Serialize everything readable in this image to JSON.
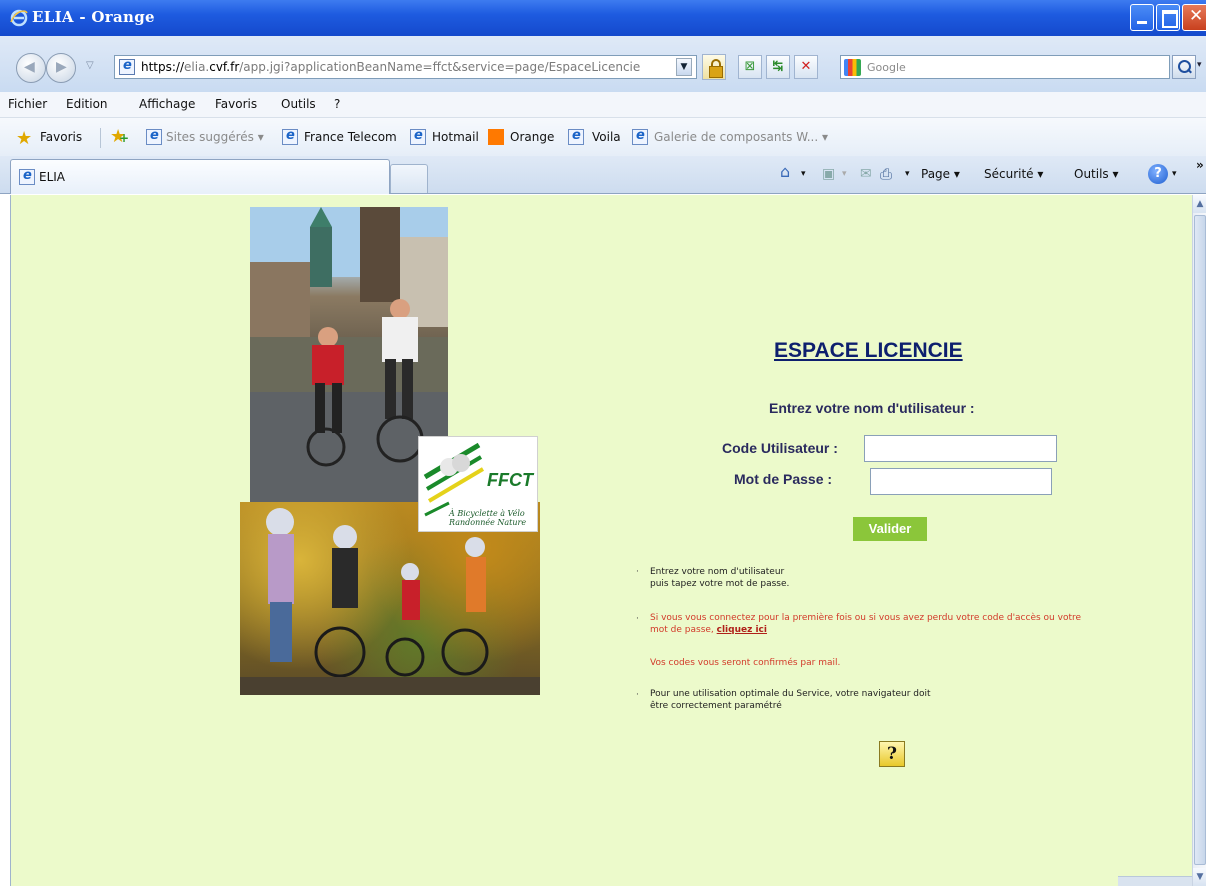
{
  "window": {
    "title": "ELIA - Orange"
  },
  "address_bar": {
    "protocol": "https://",
    "host_prefix": "elia.",
    "host_main": "cvf.fr",
    "path": "/app.jgi?applicationBeanName=ffct&service=page/EspaceLicencie"
  },
  "search": {
    "placeholder": "Google"
  },
  "menu": [
    "Fichier",
    "Edition",
    "Affichage",
    "Favoris",
    "Outils",
    "?"
  ],
  "favorites": {
    "label": "Favoris",
    "links": [
      "Sites suggérés ▾",
      "France Telecom",
      "Hotmail",
      "Orange",
      "Voila",
      "Galerie de composants W... ▾"
    ]
  },
  "tab": {
    "title": "ELIA"
  },
  "commands": {
    "page": "Page ▾",
    "security": "Sécurité ▾",
    "tools": "Outils ▾",
    "overflow": "»"
  },
  "logo": {
    "text": "FFCT",
    "sub": "À Bicyclette à Vélo Randonnée Nature"
  },
  "login": {
    "title": "ESPACE LICENCIE",
    "prompt": "Entrez votre nom d'utilisateur :",
    "code_label": "Code Utilisateur :",
    "pass_label": "Mot de Passe :",
    "submit": "Valider"
  },
  "info": {
    "b1_line1": "Entrez votre nom d'utilisateur",
    "b1_line2": "puis tapez votre mot de passe.",
    "b2_line1": "Si vous vous connectez pour la première fois ou si vous avez perdu votre code d'accès ou votre",
    "b2_line2_prefix": "mot de passe, ",
    "b2_link": "cliquez ici",
    "b2_note": "Vos codes vous seront confirmés par mail.",
    "b3_line1": "Pour une utilisation optimale du Service, votre navigateur doit",
    "b3_line2": "être correctement paramétré"
  },
  "help_button": "?"
}
